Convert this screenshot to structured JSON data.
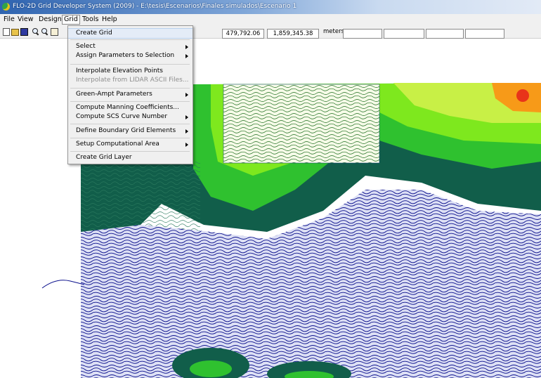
{
  "window": {
    "title": "FLO-2D Grid Developer System (2009) - E:\\tesis\\Escenarios\\Finales simulados\\Escenario 1"
  },
  "menubar": [
    "File",
    "View",
    "Design",
    "Grid",
    "Tools",
    "Help"
  ],
  "toolbar": {
    "icons": [
      "new-file-icon",
      "open-folder-icon",
      "save-icon",
      "zoom-in-icon",
      "zoom-out-icon",
      "pan-hand-icon"
    ],
    "coord_x": "479,792.06",
    "coord_y": "1,859,345.38",
    "units": "meters"
  },
  "grid_menu": {
    "create_grid": "Create Grid",
    "select": "Select",
    "assign_parameters": "Assign Parameters to Selection",
    "interpolate_elevation": "Interpolate Elevation Points",
    "interpolate_lidar": "Interpolate from  LIDAR ASCII Files...",
    "green_ampt": "Green-Ampt Parameters",
    "compute_manning": "Compute Manning Coefficients...",
    "compute_scs": "Compute SCS Curve Number",
    "define_boundary": "Define Boundary Grid Elements",
    "setup_area": "Setup Computational Area",
    "create_layer": "Create Grid Layer"
  },
  "colors": {
    "contour_blue": "#0a0f8c",
    "dark_teal": "#115e4a",
    "green": "#2fc12f",
    "light_green": "#7ee81e",
    "yellow_green": "#c8f046",
    "orange": "#f79a18",
    "red": "#e8341a"
  }
}
